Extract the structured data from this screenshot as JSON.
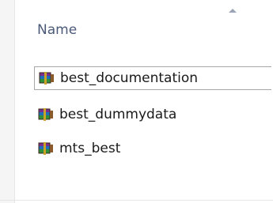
{
  "columns": {
    "name_header": "Name",
    "sort_icon": "sort-ascending-arrow"
  },
  "files": [
    {
      "label": "best_documentation",
      "icon": "winrar-archive-icon"
    },
    {
      "label": "best_dummydata",
      "icon": "winrar-archive-icon"
    },
    {
      "label": "mts_best",
      "icon": "winrar-archive-icon"
    }
  ],
  "colors": {
    "header_text": "#4a5a78",
    "item_text": "#1a1a1a",
    "focus_border": "#a7a7a7"
  }
}
